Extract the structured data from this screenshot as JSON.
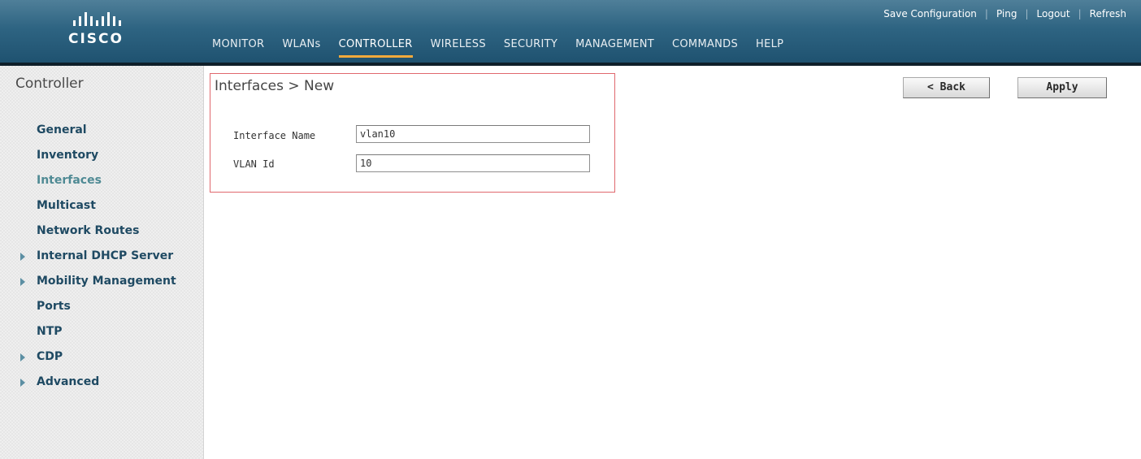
{
  "brand": {
    "name": "CISCO"
  },
  "top_links": [
    "Save Configuration",
    "Ping",
    "Logout",
    "Refresh"
  ],
  "nav": {
    "items": [
      "MONITOR",
      "WLANs",
      "CONTROLLER",
      "WIRELESS",
      "SECURITY",
      "MANAGEMENT",
      "COMMANDS",
      "HELP"
    ],
    "active": "CONTROLLER"
  },
  "sidebar": {
    "title": "Controller",
    "items": [
      {
        "label": "General",
        "expandable": false
      },
      {
        "label": "Inventory",
        "expandable": false
      },
      {
        "label": "Interfaces",
        "expandable": false,
        "current": true
      },
      {
        "label": "Multicast",
        "expandable": false
      },
      {
        "label": "Network Routes",
        "expandable": false
      },
      {
        "label": "Internal DHCP Server",
        "expandable": true
      },
      {
        "label": "Mobility Management",
        "expandable": true
      },
      {
        "label": "Ports",
        "expandable": false
      },
      {
        "label": "NTP",
        "expandable": false
      },
      {
        "label": "CDP",
        "expandable": true
      },
      {
        "label": "Advanced",
        "expandable": true
      }
    ]
  },
  "page": {
    "title": "Interfaces > New"
  },
  "buttons": {
    "back": "< Back",
    "apply": "Apply"
  },
  "form": {
    "interface_name": {
      "label": "Interface Name",
      "value": "vlan10"
    },
    "vlan_id": {
      "label": "VLAN Id",
      "value": "10"
    }
  },
  "colors": {
    "header": "#2e6482",
    "active_underline": "#f2a93b",
    "frame": "#e0686e",
    "menu_text": "#1f4a63",
    "menu_current": "#4f8a94"
  }
}
